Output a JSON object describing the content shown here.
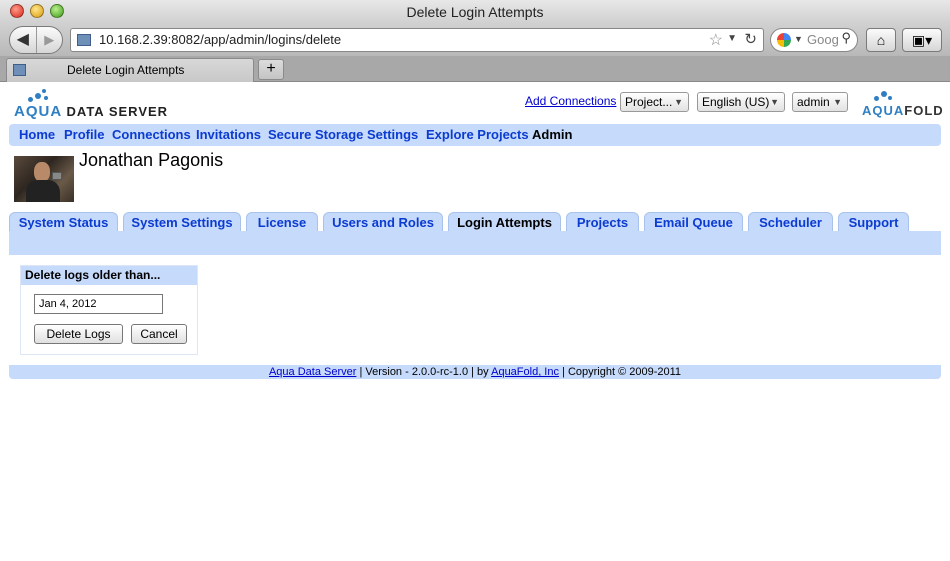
{
  "window": {
    "title": "Delete Login Attempts"
  },
  "browser": {
    "url": "10.168.2.39:8082/app/admin/logins/delete",
    "search_placeholder": "Goog",
    "tab_title": "Delete Login Attempts",
    "new_tab_label": "+",
    "back_icon": "◀",
    "forward_icon": "▶",
    "home_icon": "⌂",
    "bookmark_icon": "▣▾"
  },
  "header": {
    "logo_left": {
      "aqua": "AQUA",
      "rest": "DATA SERVER"
    },
    "logo_right": {
      "aqua": "AQUA",
      "rest": "FOLD"
    },
    "add_connections": "Add Connections",
    "project_select": "Project...",
    "language_select": "English (US)",
    "user_select": "admin"
  },
  "main_nav": [
    "Home",
    "Profile",
    "Connections",
    "Invitations",
    "Secure Storage",
    "Settings",
    "Explore Projects",
    "Admin"
  ],
  "main_nav_active": "Admin",
  "user": {
    "name": "Jonathan Pagonis"
  },
  "admin_tabs": [
    "System Status",
    "System Settings",
    "License",
    "Users and Roles",
    "Login Attempts",
    "Projects",
    "Email Queue",
    "Scheduler",
    "Support"
  ],
  "admin_tab_active": "Login Attempts",
  "panel": {
    "heading": "Delete logs older than...",
    "date_value": "Jan 4, 2012",
    "delete_button": "Delete Logs",
    "cancel_button": "Cancel"
  },
  "footer": {
    "product_link": "Aqua Data Server",
    "version_text": " | Version - 2.0.0-rc-1.0 | by ",
    "company_link": "AquaFold, Inc",
    "copyright": " | Copyright © 2009-2011"
  },
  "colors": {
    "nav_band": "#c6dafb",
    "link": "#0b3bd0"
  }
}
